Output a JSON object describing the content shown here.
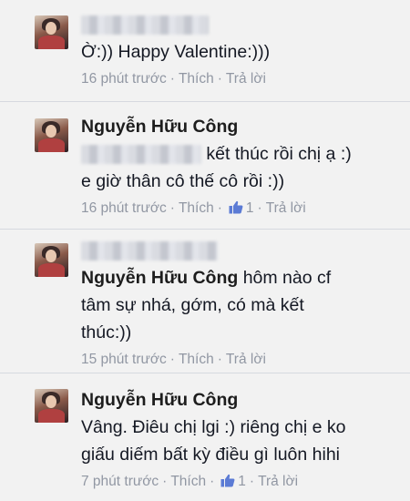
{
  "comments": [
    {
      "text_line1": "Ờ:)) Happy Valentine:)))",
      "time": "16 phút trước",
      "like": "Thích",
      "reply": "Trả lời"
    },
    {
      "author": "Nguyễn Hữu Công",
      "text_line1": "kết thúc rồi chị ạ :)",
      "text_line2": "e giờ thân cô thế cô rồi :))",
      "time": "16 phút trước",
      "like": "Thích",
      "like_count": "1",
      "reply": "Trả lời"
    },
    {
      "author": "Nguyễn Hữu Công",
      "text_line1": "hôm nào cf",
      "text_line2": "tâm sự nhá, gớm, có mà kết",
      "text_line3": "thúc:))",
      "time": "15 phút trước",
      "like": "Thích",
      "reply": "Trả lời"
    },
    {
      "author": "Nguyễn Hữu Công",
      "text_line1": "Vâng. Điêu chị lgi :) riêng chị e ko",
      "text_line2": "giấu diếm bất kỳ điều gì luôn hihi",
      "time": "7 phút trước",
      "like": "Thích",
      "like_count": "1",
      "reply": "Trả lời"
    }
  ],
  "icons": {
    "like": "thumbs-up-icon",
    "avatar": "profile-photo"
  },
  "colors": {
    "background": "#f2f2f2",
    "meta_text": "#9197a3",
    "like_icon": "#5b7bd5",
    "divider": "#d6d9df"
  }
}
